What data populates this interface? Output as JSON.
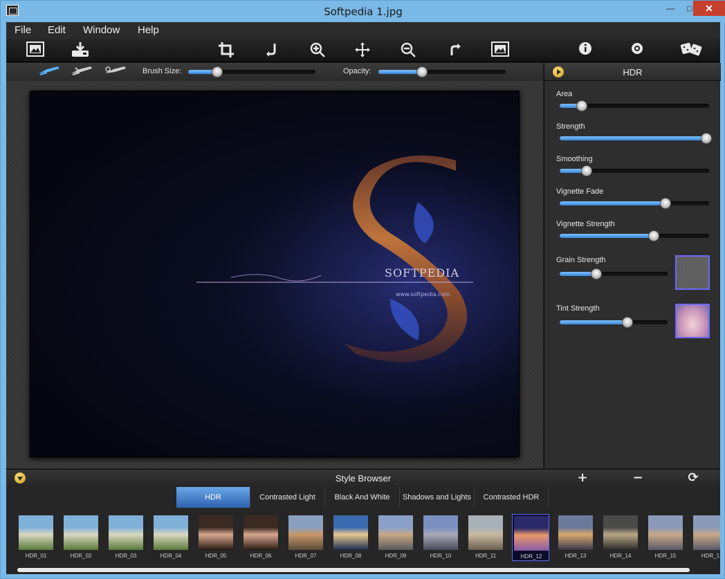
{
  "window": {
    "title": "Softpedia 1.jpg",
    "minimize": "—",
    "maximize": "□",
    "close": "✕"
  },
  "menu": {
    "items": [
      "File",
      "Edit",
      "Window",
      "Help"
    ]
  },
  "toolbar": {
    "icons": [
      "open-image-icon",
      "save-icon",
      "crop-icon",
      "straighten-icon",
      "zoom-in-icon",
      "move-icon",
      "zoom-out-icon",
      "redo-icon",
      "fit-image-icon",
      "info-icon",
      "settings-icon",
      "random-icon"
    ]
  },
  "brushbar": {
    "brush_size_label": "Brush Size:",
    "brush_size_value": 0.23,
    "opacity_label": "Opacity:",
    "opacity_value": 0.34
  },
  "watermark": {
    "text": "SOFTPEDIA",
    "url": "www.softpedia.com"
  },
  "hdr_panel": {
    "title": "HDR",
    "sliders": [
      {
        "label": "Area",
        "value": 0.15
      },
      {
        "label": "Strength",
        "value": 0.98
      },
      {
        "label": "Smoothing",
        "value": 0.18
      },
      {
        "label": "Vignette Fade",
        "value": 0.71
      },
      {
        "label": "Vignette Strength",
        "value": 0.63
      },
      {
        "label": "Grain Strength",
        "value": 0.34
      },
      {
        "label": "Tint Strength",
        "value": 0.63
      }
    ]
  },
  "style_browser": {
    "title": "Style Browser",
    "add_icon": "+",
    "remove_icon": "−",
    "refresh_icon": "⟳",
    "tabs": [
      "HDR",
      "Contrasted Light",
      "Black And White",
      "Shadows and Lights",
      "Contrasted HDR"
    ],
    "active_tab": 0,
    "thumbnails": [
      "HDR_01",
      "HDR_02",
      "HDR_03",
      "HDR_04",
      "HDR_05",
      "HDR_06",
      "HDR_07",
      "HDR_08",
      "HDR_09",
      "HDR_10",
      "HDR_11",
      "HDR_12",
      "HDR_13",
      "HDR_14",
      "HDR_15",
      "HDR_1"
    ],
    "selected_thumbnail": 11
  }
}
